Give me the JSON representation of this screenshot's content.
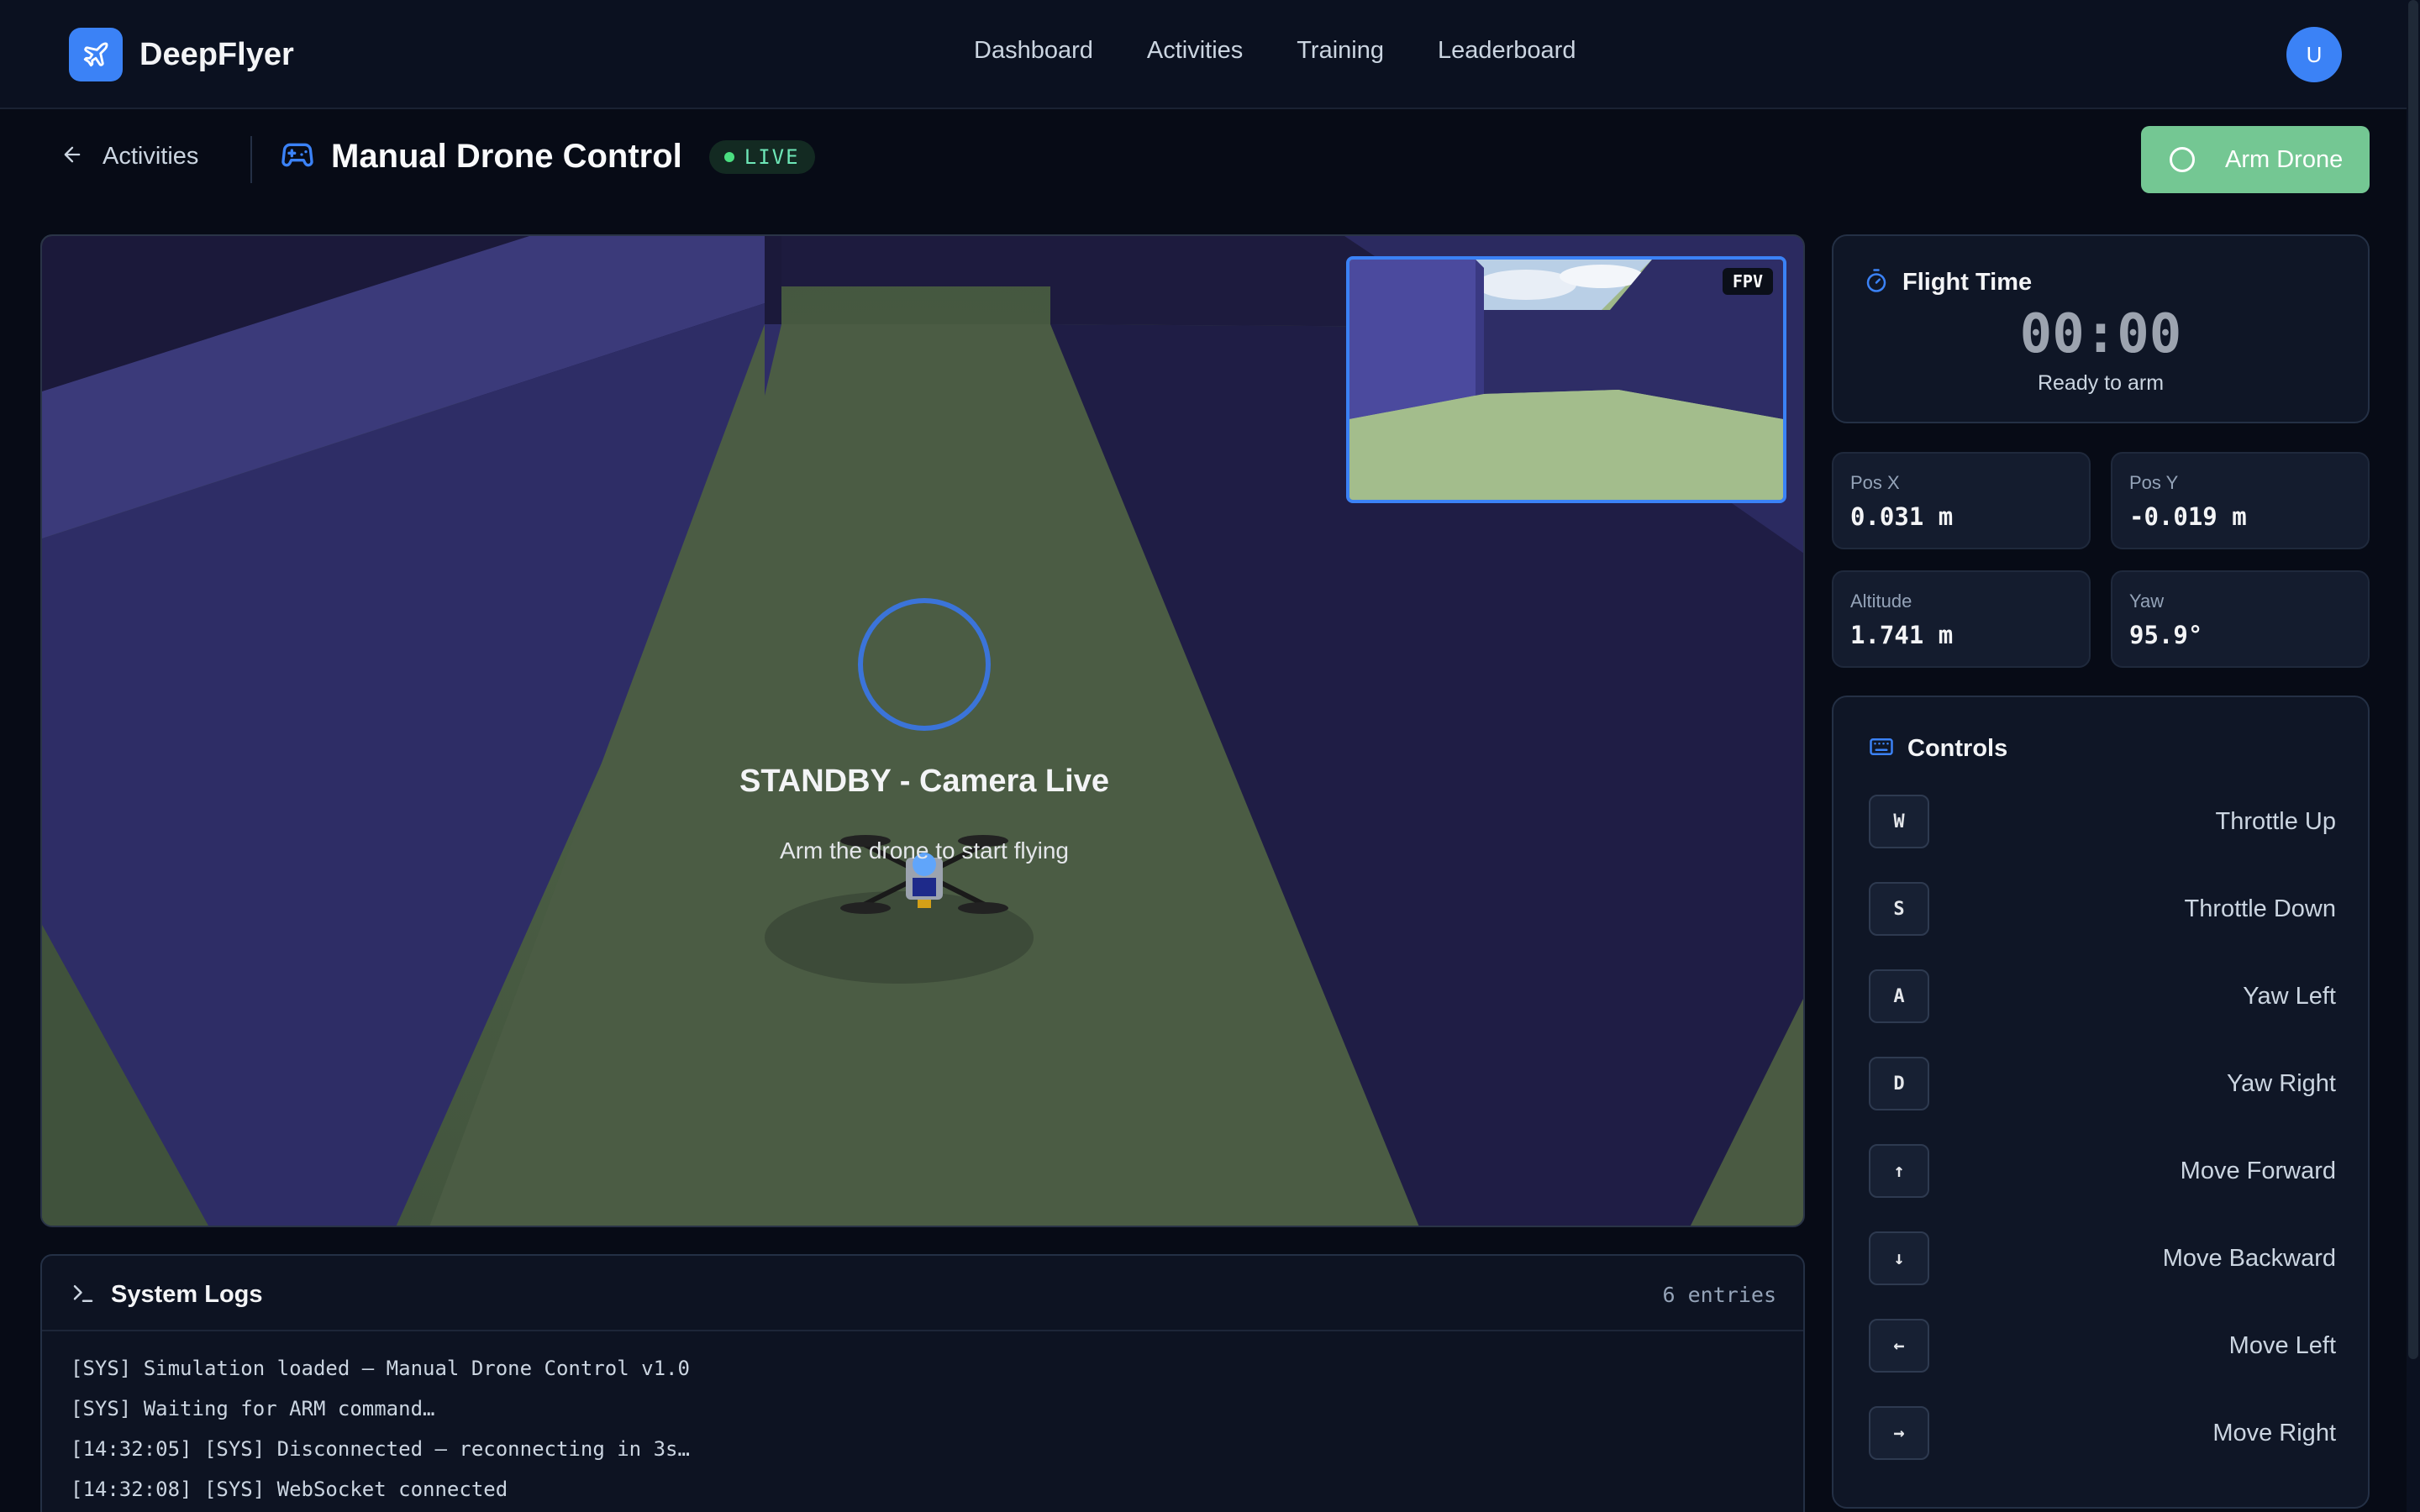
{
  "app": {
    "name": "DeepFlyer",
    "brand_icon": "plane-icon"
  },
  "nav": {
    "links": [
      "Dashboard",
      "Activities",
      "Training",
      "Leaderboard"
    ],
    "avatar_initial": "U"
  },
  "header": {
    "back_label": "Activities",
    "title": "Manual Drone Control",
    "title_icon": "gamepad-icon",
    "live_label": "LIVE",
    "arm_button_label": "Arm Drone"
  },
  "viewport": {
    "fpv_label": "FPV",
    "status_title": "STANDBY - Camera Live",
    "status_subtitle": "Arm the drone to start flying"
  },
  "logs": {
    "title": "System Logs",
    "count_label": "6 entries",
    "lines": [
      "[SYS] Simulation loaded — Manual Drone Control v1.0",
      "[SYS] Waiting for ARM command…",
      "[14:32:05] [SYS] Disconnected — reconnecting in 3s…",
      "[14:32:08] [SYS] WebSocket connected"
    ]
  },
  "flight": {
    "title": "Flight Time",
    "time": "00:00",
    "status": "Ready to arm"
  },
  "telemetry": {
    "pos_x": {
      "label": "Pos X",
      "value": "0.031 m"
    },
    "pos_y": {
      "label": "Pos Y",
      "value": "-0.019 m"
    },
    "altitude": {
      "label": "Altitude",
      "value": "1.741 m"
    },
    "yaw": {
      "label": "Yaw",
      "value": "95.9°"
    }
  },
  "controls": {
    "title": "Controls",
    "items": [
      {
        "key": "W",
        "label": "Throttle Up"
      },
      {
        "key": "S",
        "label": "Throttle Down"
      },
      {
        "key": "A",
        "label": "Yaw Left"
      },
      {
        "key": "D",
        "label": "Yaw Right"
      },
      {
        "key": "↑",
        "label": "Move Forward"
      },
      {
        "key": "↓",
        "label": "Move Backward"
      },
      {
        "key": "←",
        "label": "Move Left"
      },
      {
        "key": "→",
        "label": "Move Right"
      }
    ]
  },
  "colors": {
    "accent": "#3b82f6",
    "arm_button": "#74c793",
    "live": "#4ade80",
    "background": "#070b16"
  }
}
